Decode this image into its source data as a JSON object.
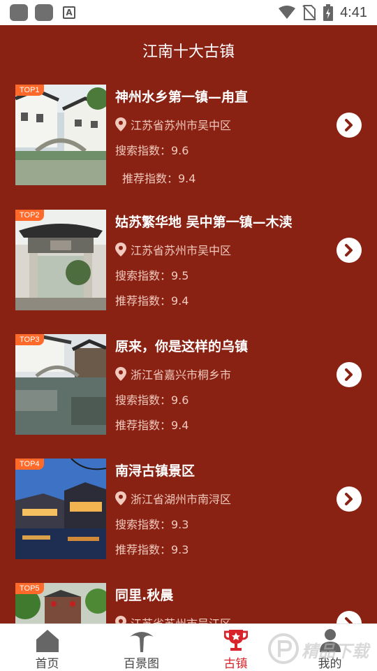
{
  "status_bar": {
    "time": "4:41"
  },
  "header": {
    "title": "江南十大古镇"
  },
  "items": [
    {
      "rank": "TOP1",
      "title": "神州水乡第一镇—甪直",
      "location": "江苏省苏州市吴中区",
      "search_index": "搜索指数：9.6",
      "recommend_index": "推荐指数：9.4"
    },
    {
      "rank": "TOP2",
      "title": "姑苏繁华地 吴中第一镇—木渎",
      "location": "江苏省苏州市吴中区",
      "search_index": "搜索指数：9.5",
      "recommend_index": "推荐指数：9.4"
    },
    {
      "rank": "TOP3",
      "title": "原来，你是这样的乌镇",
      "location": "浙江省嘉兴市桐乡市",
      "search_index": "搜索指数：9.6",
      "recommend_index": "推荐指数：9.4"
    },
    {
      "rank": "TOP4",
      "title": "南浔古镇景区",
      "location": "浙江省湖州市南浔区",
      "search_index": "搜索指数：9.3",
      "recommend_index": "推荐指数：9.3"
    },
    {
      "rank": "TOP5",
      "title": "同里.秋晨",
      "location": "江苏省苏州市吴江区",
      "search_index": "",
      "recommend_index": ""
    }
  ],
  "tabs": [
    {
      "label": "首页",
      "icon": "home-icon"
    },
    {
      "label": "百景图",
      "icon": "tree-icon"
    },
    {
      "label": "古镇",
      "icon": "trophy-icon",
      "active": true
    },
    {
      "label": "我的",
      "icon": "user-icon"
    }
  ],
  "colors": {
    "background": "#8a2214",
    "badge": "#ff6a2a",
    "active_tab": "#d8232a"
  }
}
